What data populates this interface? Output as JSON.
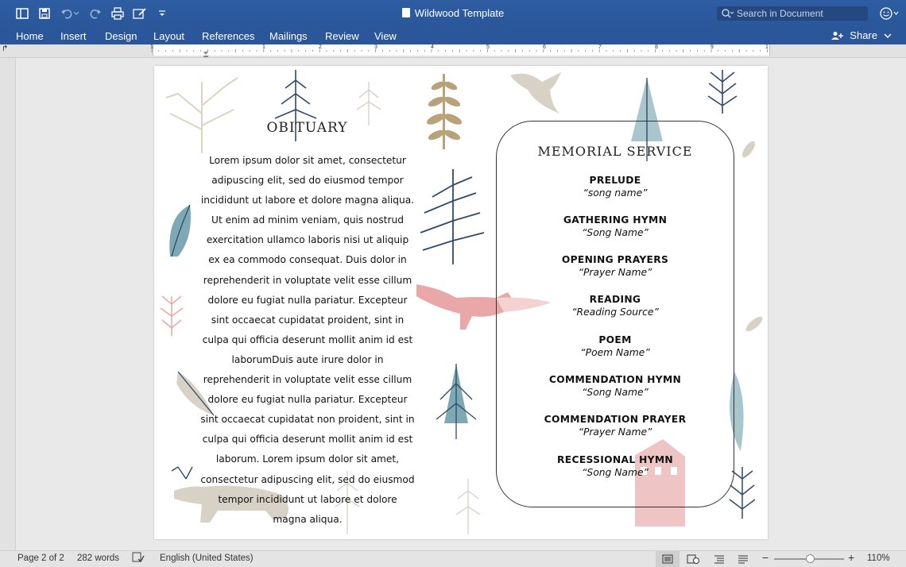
{
  "window": {
    "title": "Wildwood Template"
  },
  "search": {
    "placeholder": "Search in Document"
  },
  "ribbon": {
    "tabs": [
      "Home",
      "Insert",
      "Design",
      "Layout",
      "References",
      "Mailings",
      "Review",
      "View"
    ],
    "share_label": "Share"
  },
  "ruler": {
    "labels": [
      "1",
      "1",
      "2",
      "3",
      "4",
      "5",
      "6",
      "7",
      "8",
      "9",
      "1"
    ]
  },
  "document": {
    "obituary_title": "OBITUARY",
    "obituary_text": "Lorem ipsum dolor sit amet, consectetur adipuscing elit, sed do eiusmod tempor incididunt ut labore et dolore magna aliqua. Ut enim ad minim veniam, quis nostrud exercitation ullamco laboris nisi ut aliquip ex ea commodo consequat. Duis dolor in reprehenderit in voluptate velit esse cillum dolore eu fugiat nulla pariatur. Excepteur sint occaecat cupidatat proident, sint in culpa qui officia deserunt mollit anim id est laborumDuis aute irure dolor in reprehenderit in voluptate velit esse cillum dolore eu fugiat nulla pariatur. Excepteur sint occaecat cupidatat non proident, sint in culpa qui officia deserunt mollit anim id est laborum. Lorem ipsum dolor sit amet, consectetur adipuscing elit, sed do eiusmod tempor incididunt ut labore et dolore magna aliqua.",
    "memorial_title": "MEMORIAL SERVICE",
    "program": [
      {
        "heading": "PRELUDE",
        "sub": "“song name”"
      },
      {
        "heading": "GATHERING HYMN",
        "sub": "“Song Name”"
      },
      {
        "heading": "OPENING PRAYERS",
        "sub": "“Prayer Name”"
      },
      {
        "heading": "READING",
        "sub": "“Reading Source”"
      },
      {
        "heading": "POEM",
        "sub": "“Poem Name”"
      },
      {
        "heading": "COMMENDATION HYMN",
        "sub": "“Song Name”"
      },
      {
        "heading": "COMMENDATION PRAYER",
        "sub": "“Prayer Name”"
      },
      {
        "heading": "RECESSIONAL HYMN",
        "sub": "“Song Name”"
      }
    ]
  },
  "status": {
    "page": "Page 2 of 2",
    "words": "282 words",
    "language": "English (United States)",
    "zoom": "110%"
  },
  "colors": {
    "ribbon_blue": "#2b579a",
    "deco_navy": "#2f4a68",
    "deco_tan": "#b9a27a",
    "deco_teal": "#7ea8b3",
    "deco_pink": "#e9a7a7"
  }
}
